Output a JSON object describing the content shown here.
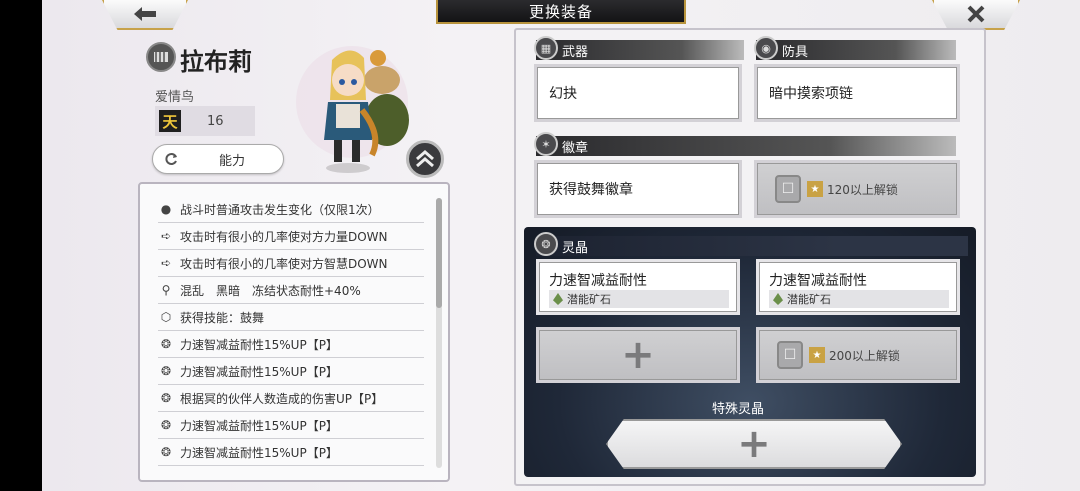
{
  "header": {
    "title": "更换装备",
    "back_icon": "arrow-left-icon",
    "close_icon": "close-x-icon"
  },
  "character": {
    "name": "拉布莉",
    "title": "爱情鸟",
    "rank_badge": "天",
    "level": "16",
    "ability_label": "能力"
  },
  "effects": [
    {
      "icon": "person-icon",
      "text": "战斗时普通攻击发生变化（仅限1次）"
    },
    {
      "icon": "claw-icon",
      "text": "攻击时有很小的几率使对方力量DOWN"
    },
    {
      "icon": "claw-icon",
      "text": "攻击时有很小的几率使对方智慧DOWN"
    },
    {
      "icon": "resist-icon",
      "text": "混乱　黑暗　冻结状态耐性+40%"
    },
    {
      "icon": "skill-icon",
      "text": "获得技能：鼓舞"
    },
    {
      "icon": "crystal-icon",
      "text": "力速智减益耐性15%UP【P】"
    },
    {
      "icon": "crystal-icon",
      "text": "力速智减益耐性15%UP【P】"
    },
    {
      "icon": "crystal-icon",
      "text": "根据冥的伙伴人数造成的伤害UP【P】"
    },
    {
      "icon": "crystal-icon",
      "text": "力速智减益耐性15%UP【P】"
    },
    {
      "icon": "crystal-icon",
      "text": "力速智减益耐性15%UP【P】"
    }
  ],
  "equipment": {
    "weapon_label": "武器",
    "armor_label": "防具",
    "emblem_label": "徽章",
    "weapon": "幻抉",
    "armor": "暗中摸索项链",
    "emblem": "获得鼓舞徽章",
    "emblem_locked": "120以上解锁"
  },
  "spirit": {
    "label": "灵晶",
    "slot1_name": "力速智减益耐性",
    "slot1_sub": "潜能矿石",
    "slot2_name": "力速智减益耐性",
    "slot2_sub": "潜能矿石",
    "locked_text": "200以上解锁",
    "special_label": "特殊灵晶"
  },
  "colors": {
    "accent_gold": "#c7a24a",
    "dark_panel": "#1f2838"
  }
}
